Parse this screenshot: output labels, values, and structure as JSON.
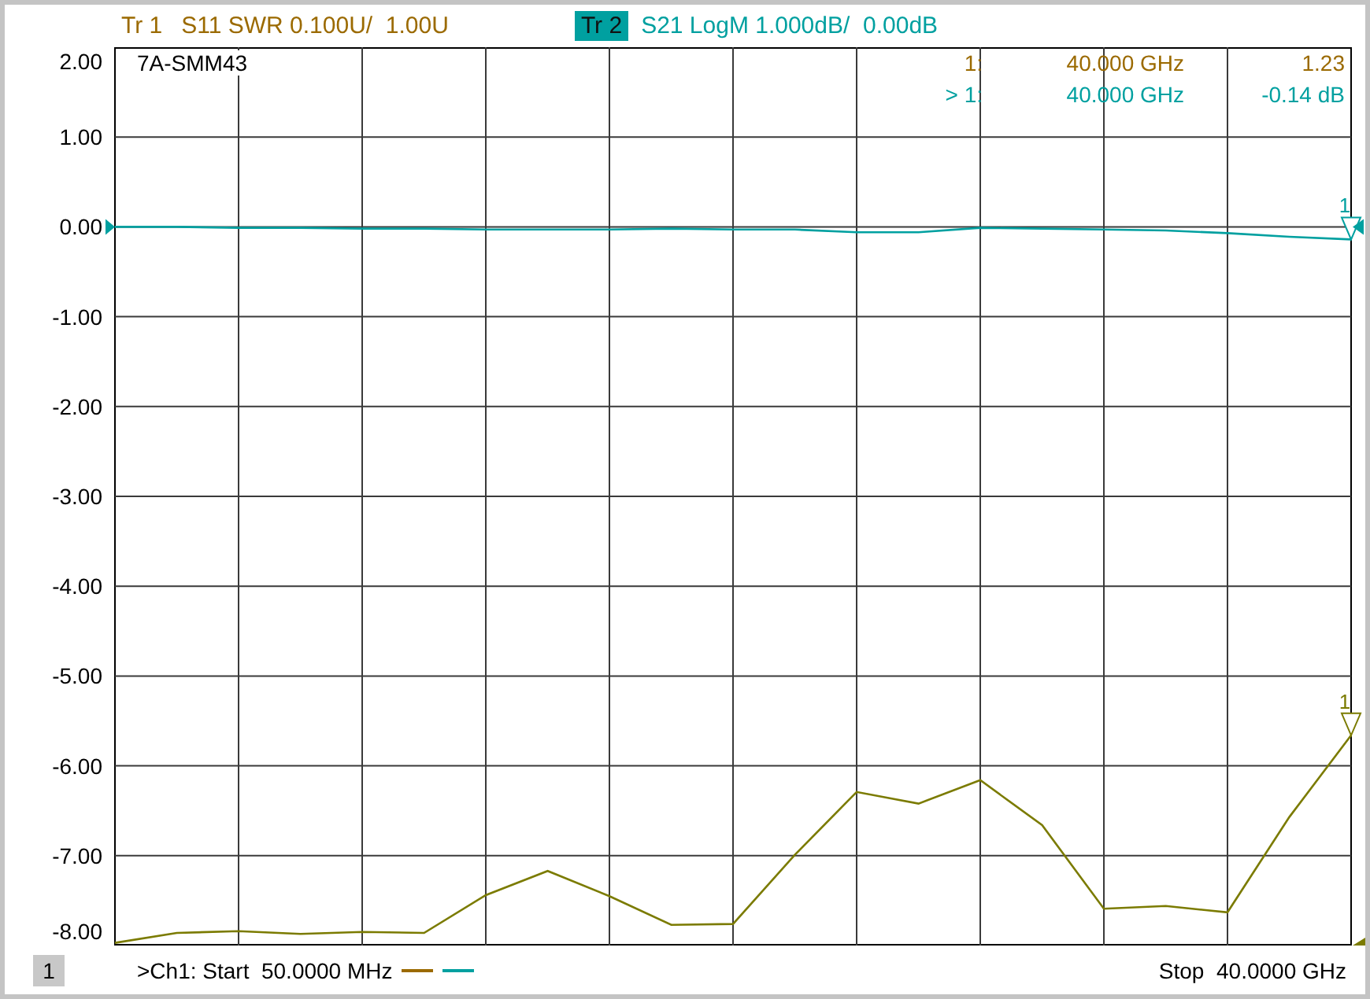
{
  "traces": [
    {
      "label": "Tr 1",
      "description": "S11 SWR 0.100U/  1.00U",
      "color": "#9b6a00",
      "selected": false
    },
    {
      "label": "Tr 2",
      "description": "S21 LogM 1.000dB/  0.00dB",
      "color": "#00a0a0",
      "selected": true
    }
  ],
  "plot": {
    "title": "7A-SMM43",
    "marker_readouts": [
      {
        "label": "1:",
        "frequency": "40.000 GHz",
        "value": "1.23",
        "color": "#9b6a00"
      },
      {
        "label": "> 1:",
        "frequency": "40.000 GHz",
        "value": "-0.14 dB",
        "color": "#00a0a0"
      }
    ],
    "chart_data": {
      "type": "line",
      "categories": [
        null,
        null,
        null,
        null,
        null,
        null,
        null,
        null,
        null,
        null,
        null,
        null,
        null,
        null,
        null,
        null,
        null,
        null,
        null,
        null,
        null
      ],
      "series": [
        {
          "color": "#7b7b00",
          "values": [
            -7.97,
            -7.86,
            -7.84,
            -7.87,
            -7.85,
            -7.86,
            -7.44,
            -7.17,
            -7.45,
            -7.77,
            -7.76,
            -6.99,
            -6.29,
            -6.42,
            -6.16,
            -6.66,
            -7.59,
            -7.56,
            -7.63,
            -6.57,
            -5.66
          ]
        },
        {
          "color": "#00a0a0",
          "values": [
            0,
            0,
            -0.01,
            -0.01,
            -0.02,
            -0.02,
            -0.03,
            -0.03,
            -0.03,
            -0.02,
            -0.03,
            -0.03,
            -0.06,
            -0.06,
            -0.01,
            -0.02,
            -0.03,
            -0.04,
            -0.07,
            -0.11,
            -0.14
          ]
        }
      ],
      "ylim": [
        -8,
        2
      ],
      "grid": true,
      "yticks": [
        {
          "value": 2,
          "label": "2.00"
        },
        {
          "value": 1,
          "label": "1.00"
        },
        {
          "value": 0,
          "label": "0.00"
        },
        {
          "value": -1,
          "label": "-1.00"
        },
        {
          "value": -2,
          "label": "-2.00"
        },
        {
          "value": -3,
          "label": "-3.00"
        },
        {
          "value": -4,
          "label": "-4.00"
        },
        {
          "value": -5,
          "label": "-5.00"
        },
        {
          "value": -6,
          "label": "-6.00"
        },
        {
          "value": -7,
          "label": "-7.00"
        },
        {
          "value": -8,
          "label": "-8.00"
        }
      ]
    },
    "markers": [
      {
        "label": "1"
      },
      {
        "label": "1"
      }
    ]
  },
  "footer": {
    "channel": "1",
    "start": ">Ch1: Start  50.0000 MHz",
    "stop": "Stop  40.0000 GHz"
  }
}
